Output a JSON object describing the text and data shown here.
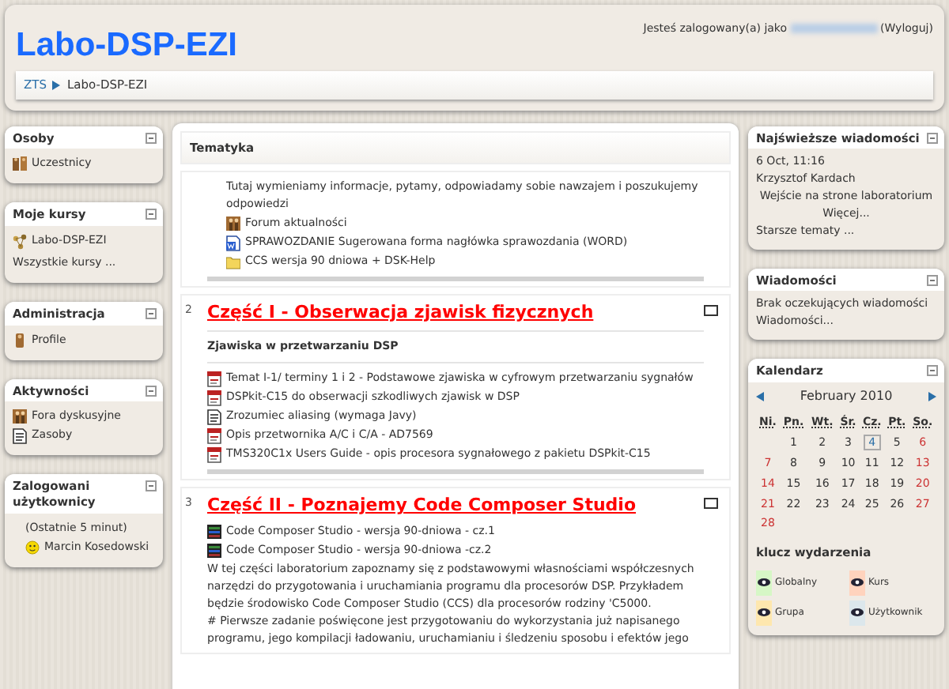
{
  "header": {
    "title": "Labo-DSP-EZI",
    "login_text": "Jesteś zalogowany(a) jako",
    "logout": "(Wyloguj)"
  },
  "breadcrumb": [
    {
      "label": "ZTS",
      "link": true
    },
    {
      "label": "Labo-DSP-EZI",
      "link": false
    }
  ],
  "left_blocks": [
    {
      "title": "Osoby",
      "items": [
        {
          "kind": "people",
          "label": "Uczestnicy"
        }
      ]
    },
    {
      "title": "Moje kursy",
      "items": [
        {
          "kind": "course",
          "label": "Labo-DSP-EZI"
        },
        {
          "kind": "more",
          "label": "Wszystkie kursy ..."
        }
      ]
    },
    {
      "title": "Administracja",
      "items": [
        {
          "kind": "profile",
          "label": "Profile"
        }
      ]
    },
    {
      "title": "Aktywności",
      "items": [
        {
          "kind": "forum",
          "label": "Fora dyskusyjne"
        },
        {
          "kind": "resource",
          "label": "Zasoby"
        }
      ]
    },
    {
      "title": "Zalogowani użytkownicy",
      "items": [
        {
          "kind": "note",
          "label": "(Ostatnie 5 minut)"
        },
        {
          "kind": "user",
          "label": "Marcin Kosedowski"
        }
      ]
    }
  ],
  "main": {
    "title": "Tematyka",
    "sections": [
      {
        "summary": "Tutaj wymieniamy informacje, pytamy, odpowiadamy sobie nawzajem i poszukujemy odpowiedzi",
        "items": [
          {
            "kind": "forum",
            "label": "Forum aktualności"
          },
          {
            "kind": "word",
            "label": "SPRAWOZDANIE Sugerowana forma nagłówka sprawozdania (WORD)"
          },
          {
            "kind": "folder",
            "label": "CCS wersja 90 dniowa + DSK-Help"
          }
        ]
      },
      {
        "number": "2",
        "title": "Część I - Obserwacja zjawisk fizycznych",
        "subtitle": "Zjawiska w przetwarzaniu DSP",
        "items": [
          {
            "kind": "pdf",
            "label": "Temat I-1/ terminy 1 i 2 - Podstawowe zjawiska w cyfrowym przetwarzaniu sygnałów"
          },
          {
            "kind": "pdf",
            "label": "DSPkit-C15 do obserwacji szkodliwych zjawisk w DSP"
          },
          {
            "kind": "resource",
            "label": "Zrozumiec aliasing (wymaga Javy)"
          },
          {
            "kind": "pdf",
            "label": "Opis przetwornika A/C i C/A - AD7569"
          },
          {
            "kind": "pdf",
            "label": "TMS320C1x Users Guide - opis procesora sygnałowego z pakietu DSPkit-C15"
          }
        ]
      },
      {
        "number": "3",
        "title": "Część II - Poznajemy Code Composer Studio",
        "items": [
          {
            "kind": "video",
            "label": "Code Composer Studio - wersja 90-dniowa - cz.1"
          },
          {
            "kind": "video",
            "label": "Code Composer Studio - wersja 90-dniowa -cz.2"
          }
        ],
        "paragraphs": [
          "W tej części laboratorium zapoznamy się z podstawowymi własnościami współczesnych narzędzi do przygotowania i uruchamiania programu dla procesorów DSP. Przykładem będzie środowisko Code Composer Studio (CCS) dla procesorów rodziny 'C5000.",
          "# Pierwsze zadanie poświęcone jest przygotowaniu do wykorzystania już napisanego programu, jego kompilacji ładowaniu, uruchamianiu i śledzeniu sposobu i efektów jego"
        ]
      }
    ]
  },
  "news": {
    "title": "Najświeższe wiadomości",
    "date": "6 Oct, 11:16",
    "author": "Krzysztof Kardach",
    "subject": "Wejście na strone laboratorium",
    "more": "Więcej...",
    "older": "Starsze tematy ..."
  },
  "messages": {
    "title": "Wiadomości",
    "text": "Brak oczekujących wiadomości",
    "link": "Wiadomości..."
  },
  "calendar": {
    "title": "Kalendarz",
    "month": "February 2010",
    "weekdays": [
      "Ni.",
      "Pn.",
      "Wt.",
      "Śr.",
      "Cz.",
      "Pt.",
      "So."
    ],
    "weeks": [
      [
        {
          "label": "1",
          "today": false
        },
        {
          "label": "2",
          "today": false
        },
        {
          "label": "3",
          "today": false
        },
        {
          "label": "4",
          "today": true
        },
        {
          "label": "5",
          "today": false
        },
        {
          "label": "6",
          "today": false
        }
      ],
      [
        {
          "label": "7",
          "today": false
        },
        {
          "label": "8",
          "today": false
        },
        {
          "label": "9",
          "today": false
        },
        {
          "label": "10",
          "today": false
        },
        {
          "label": "11",
          "today": false
        },
        {
          "label": "12",
          "today": false
        },
        {
          "label": "13",
          "today": false
        }
      ],
      [
        {
          "label": "14",
          "today": false
        },
        {
          "label": "15",
          "today": false
        },
        {
          "label": "16",
          "today": false
        },
        {
          "label": "17",
          "today": false
        },
        {
          "label": "18",
          "today": false
        },
        {
          "label": "19",
          "today": false
        },
        {
          "label": "20",
          "today": false
        }
      ],
      [
        {
          "label": "21",
          "today": false
        },
        {
          "label": "22",
          "today": false
        },
        {
          "label": "23",
          "today": false
        },
        {
          "label": "24",
          "today": false
        },
        {
          "label": "25",
          "today": false
        },
        {
          "label": "26",
          "today": false
        },
        {
          "label": "27",
          "today": false
        }
      ],
      [
        {
          "label": "28",
          "today": false
        }
      ]
    ],
    "key_title": "klucz wydarzenia",
    "key": [
      {
        "label": "Globalny",
        "color": "#d6f7c6"
      },
      {
        "label": "Kurs",
        "color": "#ffd3bd"
      },
      {
        "label": "Grupa",
        "color": "#fee7ae"
      },
      {
        "label": "Użytkownik",
        "color": "#dce7ec"
      }
    ]
  }
}
